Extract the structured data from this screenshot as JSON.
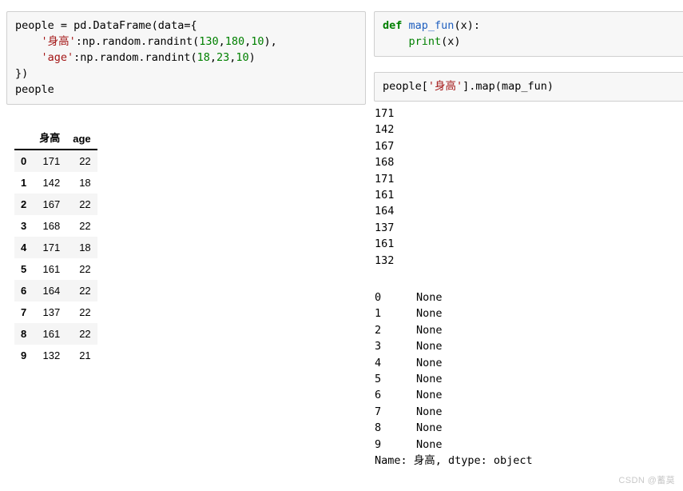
{
  "cells": {
    "people_def": {
      "name": "people-dataframe-definition",
      "lines": [
        [
          {
            "t": "people = pd.DataFrame(data={",
            "c": "plain"
          }
        ],
        [
          {
            "t": "    ",
            "c": "plain"
          },
          {
            "t": "'身高'",
            "c": "str"
          },
          {
            "t": ":np.random.randint(",
            "c": "plain"
          },
          {
            "t": "130",
            "c": "num"
          },
          {
            "t": ",",
            "c": "plain"
          },
          {
            "t": "180",
            "c": "num"
          },
          {
            "t": ",",
            "c": "plain"
          },
          {
            "t": "10",
            "c": "num"
          },
          {
            "t": "),",
            "c": "plain"
          }
        ],
        [
          {
            "t": "    ",
            "c": "plain"
          },
          {
            "t": "'age'",
            "c": "str"
          },
          {
            "t": ":np.random.randint(",
            "c": "plain"
          },
          {
            "t": "18",
            "c": "num"
          },
          {
            "t": ",",
            "c": "plain"
          },
          {
            "t": "23",
            "c": "num"
          },
          {
            "t": ",",
            "c": "plain"
          },
          {
            "t": "10",
            "c": "num"
          },
          {
            "t": ")",
            "c": "plain"
          }
        ],
        [
          {
            "t": "})",
            "c": "plain"
          }
        ],
        [
          {
            "t": "people",
            "c": "plain"
          }
        ]
      ]
    },
    "map_fun": {
      "name": "map-fun-definition",
      "lines": [
        [
          {
            "t": "def",
            "c": "kw"
          },
          {
            "t": " ",
            "c": "plain"
          },
          {
            "t": "map_fun",
            "c": "fn"
          },
          {
            "t": "(x):",
            "c": "plain"
          }
        ],
        [
          {
            "t": "    ",
            "c": "plain"
          },
          {
            "t": "print",
            "c": "builtin"
          },
          {
            "t": "(x)",
            "c": "plain"
          }
        ]
      ]
    },
    "map_call": {
      "name": "map-call-statement",
      "lines": [
        [
          {
            "t": "people[",
            "c": "plain"
          },
          {
            "t": "'身高'",
            "c": "str"
          },
          {
            "t": "].map(map_fun)",
            "c": "plain"
          }
        ]
      ]
    }
  },
  "dataframe": {
    "index_header": "",
    "columns": [
      "身高",
      "age"
    ],
    "index": [
      "0",
      "1",
      "2",
      "3",
      "4",
      "5",
      "6",
      "7",
      "8",
      "9"
    ],
    "rows": [
      [
        "171",
        "22"
      ],
      [
        "142",
        "18"
      ],
      [
        "167",
        "22"
      ],
      [
        "168",
        "22"
      ],
      [
        "171",
        "18"
      ],
      [
        "161",
        "22"
      ],
      [
        "164",
        "22"
      ],
      [
        "137",
        "22"
      ],
      [
        "161",
        "22"
      ],
      [
        "132",
        "21"
      ]
    ]
  },
  "print_output": {
    "lines": [
      "171",
      "142",
      "167",
      "168",
      "171",
      "161",
      "164",
      "137",
      "161",
      "132"
    ]
  },
  "series_output": {
    "rows": [
      {
        "index": "0",
        "value": "None"
      },
      {
        "index": "1",
        "value": "None"
      },
      {
        "index": "2",
        "value": "None"
      },
      {
        "index": "3",
        "value": "None"
      },
      {
        "index": "4",
        "value": "None"
      },
      {
        "index": "5",
        "value": "None"
      },
      {
        "index": "6",
        "value": "None"
      },
      {
        "index": "7",
        "value": "None"
      },
      {
        "index": "8",
        "value": "None"
      },
      {
        "index": "9",
        "value": "None"
      }
    ],
    "footer": "Name: 身高, dtype: object"
  },
  "watermark": {
    "text": "CSDN @蓄莫"
  },
  "colors": {
    "cell_background": "#f7f7f7",
    "cell_border": "#cfcfcf",
    "string_token": "#a31515",
    "number_token": "#008000",
    "keyword_token": "#008000",
    "function_token": "#1f5fbf",
    "table_stripe": "#f5f5f5",
    "watermark": "#c8c8c8"
  }
}
